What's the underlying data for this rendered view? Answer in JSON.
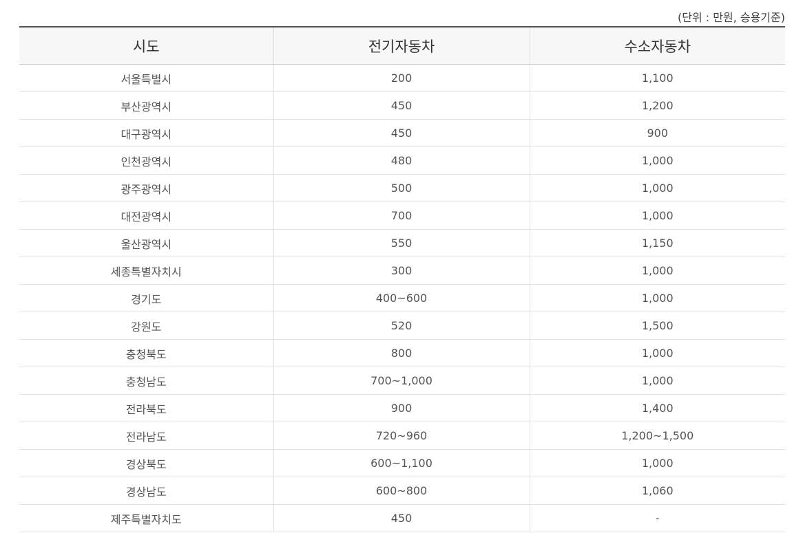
{
  "unit_note": "(단위 : 만원, 승용기준)",
  "table": {
    "headers": [
      "시도",
      "전기자동차",
      "수소자동차"
    ],
    "rows": [
      [
        "서울특별시",
        "200",
        "1,100"
      ],
      [
        "부산광역시",
        "450",
        "1,200"
      ],
      [
        "대구광역시",
        "450",
        "900"
      ],
      [
        "인천광역시",
        "480",
        "1,000"
      ],
      [
        "광주광역시",
        "500",
        "1,000"
      ],
      [
        "대전광역시",
        "700",
        "1,000"
      ],
      [
        "울산광역시",
        "550",
        "1,150"
      ],
      [
        "세종특별자치시",
        "300",
        "1,000"
      ],
      [
        "경기도",
        "400~600",
        "1,000"
      ],
      [
        "강원도",
        "520",
        "1,500"
      ],
      [
        "충청북도",
        "800",
        "1,000"
      ],
      [
        "충청남도",
        "700~1,000",
        "1,000"
      ],
      [
        "전라북도",
        "900",
        "1,400"
      ],
      [
        "전라남도",
        "720~960",
        "1,200~1,500"
      ],
      [
        "경상북도",
        "600~1,100",
        "1,000"
      ],
      [
        "경상남도",
        "600~800",
        "1,060"
      ],
      [
        "제주특별자치도",
        "450",
        "-"
      ]
    ]
  }
}
